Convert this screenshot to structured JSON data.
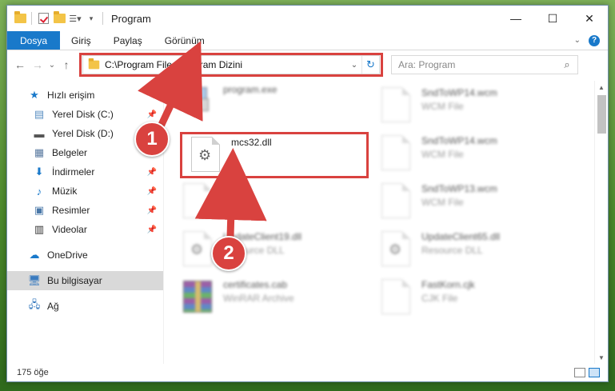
{
  "window": {
    "title": "Program"
  },
  "window_controls": {
    "minimize": "—",
    "maximize": "☐",
    "close": "✕"
  },
  "ribbon": {
    "tabs": [
      {
        "label": "Dosya"
      },
      {
        "label": "Giriş"
      },
      {
        "label": "Paylaş"
      },
      {
        "label": "Görünüm"
      }
    ],
    "help": "?"
  },
  "navbar": {
    "back": "←",
    "forward": "→",
    "recent": "⌄",
    "up": "↑",
    "address": "C:\\Program Files\\Program Dizini",
    "refresh": "↻",
    "search_placeholder": "Ara: Program"
  },
  "sidebar": {
    "quick_access": "Hızlı erişim",
    "items": [
      {
        "label": "Yerel Disk (C:)",
        "icon": "drive-icon",
        "pinned": true
      },
      {
        "label": "Yerel Disk (D:)",
        "icon": "drive-icon",
        "pinned": true
      },
      {
        "label": "Belgeler",
        "icon": "documents-icon",
        "pinned": false
      },
      {
        "label": "İndirmeler",
        "icon": "downloads-icon",
        "pinned": true
      },
      {
        "label": "Müzik",
        "icon": "music-icon",
        "pinned": true
      },
      {
        "label": "Resimler",
        "icon": "pictures-icon",
        "pinned": true
      },
      {
        "label": "Videolar",
        "icon": "videos-icon",
        "pinned": true
      }
    ],
    "onedrive": "OneDrive",
    "this_pc": "Bu bilgisayar",
    "network": "Ağ"
  },
  "files": [
    {
      "name": "program.exe",
      "type": "",
      "icon": "exe-icon"
    },
    {
      "name": "mcs32.dll",
      "type": "",
      "icon": "dll-icon"
    },
    {
      "name": "...d.cjk",
      "type": "",
      "icon": "file-icon"
    },
    {
      "name": "UpdateClient19.dll",
      "type": "Resource DLL",
      "icon": "dll-icon"
    },
    {
      "name": "certificates.cab",
      "type": "WinRAR Archive",
      "icon": "rar-icon"
    },
    {
      "name": "SndToWP14.wcm",
      "type": "WCM File",
      "icon": "file-icon"
    },
    {
      "name": "SndToWP14.wcm",
      "type": "WCM File",
      "icon": "file-icon"
    },
    {
      "name": "SndToWP13.wcm",
      "type": "WCM File",
      "icon": "file-icon"
    },
    {
      "name": "UpdateClient65.dll",
      "type": "Resource DLL",
      "icon": "dll-icon"
    },
    {
      "name": "FastKorn.cjk",
      "type": "CJK File",
      "icon": "file-icon"
    }
  ],
  "status": {
    "count": "175 öğe"
  },
  "annotations": [
    {
      "label": "1"
    },
    {
      "label": "2"
    }
  ],
  "colors": {
    "accent": "#1979ca",
    "highlight": "#d9423f"
  }
}
